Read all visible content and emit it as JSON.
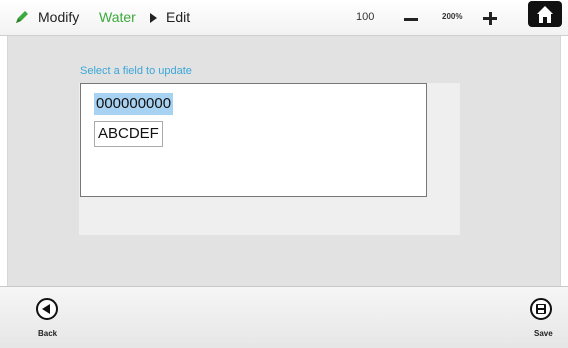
{
  "header": {
    "breadcrumb": {
      "action": "Modify",
      "object": "Water",
      "view": "Edit"
    },
    "zoom": {
      "value": "100",
      "max_label": "200%"
    },
    "icons": {
      "edit": "pencil-icon",
      "home": "home-icon",
      "minus": "minus-icon",
      "plus": "plus-icon"
    }
  },
  "main": {
    "prompt": "Select a field to update",
    "fields": [
      {
        "value": "000000000",
        "selected": true
      },
      {
        "value": "ABCDEF",
        "selected": false
      }
    ]
  },
  "footer": {
    "back_label": "Back",
    "save_label": "Save",
    "icons": {
      "back": "back-arrow-icon",
      "save": "floppy-disk-icon"
    }
  },
  "colors": {
    "accent_green": "#3caa3c",
    "prompt_blue": "#3aa6d8",
    "selection": "#a8d2f2"
  }
}
